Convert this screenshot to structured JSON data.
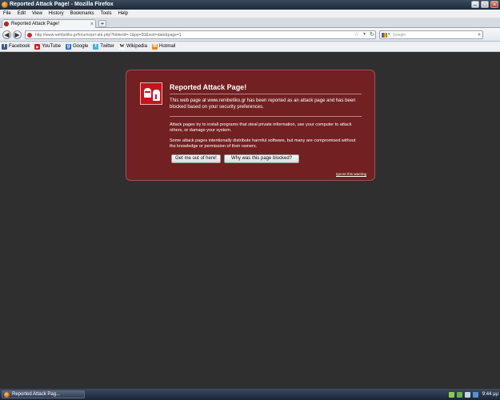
{
  "window": {
    "title": "Reported Attack Page! - Mozilla Firefox",
    "buttons": {
      "minimize": "–",
      "maximize": "□",
      "close": "×"
    }
  },
  "menu": [
    "File",
    "Edit",
    "View",
    "History",
    "Bookmarks",
    "Tools",
    "Help"
  ],
  "tab": {
    "label": "Reported Attack Page!",
    "close": "×",
    "new_tab": "+"
  },
  "nav": {
    "back": "◀",
    "forward": "▶",
    "url": "http://www.rembetiko.gr/forums/pri-ate.php?folderid=-1&pp=50&sort=date&page=1",
    "star": "☆",
    "dropdown": "▾",
    "reload": "↻",
    "search_placeholder": "Google",
    "search_dropdown": "▾",
    "search_icon": "⌕"
  },
  "bookmarks": [
    {
      "label": "Facebook",
      "icon": "facebook-icon",
      "color": "#3b5998",
      "glyph": "f"
    },
    {
      "label": "YouTube",
      "icon": "youtube-icon",
      "color": "#cc2020",
      "glyph": "▶"
    },
    {
      "label": "Google",
      "icon": "google-icon",
      "color": "#2d6be3",
      "glyph": "g"
    },
    {
      "label": "Twitter",
      "icon": "twitter-icon",
      "color": "#3fb0e6",
      "glyph": "t"
    },
    {
      "label": "Wikipedia",
      "icon": "wikipedia-icon",
      "color": "#ffffff",
      "glyph": "W"
    },
    {
      "label": "Hotmail",
      "icon": "hotmail-icon",
      "color": "#e38b1b",
      "glyph": "✉"
    }
  ],
  "error": {
    "title": "Reported Attack Page!",
    "short_desc": "This web page at www.rembetiko.gr has been reported as an attack page and has been blocked based on your security preferences.",
    "long_desc_1": "Attack pages try to install programs that steal private information, use your computer to attack others, or damage your system.",
    "long_desc_2": "Some attack pages intentionally distribute harmful software, but many are compromised without the knowledge or permission of their owners.",
    "get_me_out": "Get me out of here!",
    "why_blocked": "Why was this page blocked?",
    "ignore": "Ignore this warning"
  },
  "taskbar": {
    "task_label": "Reported Attack Pag...",
    "time": "9:44 μμ"
  },
  "colors": {
    "error_bg": "#722021",
    "desktop_bg": "#2f2f2f",
    "shield_red": "#c8121e"
  }
}
